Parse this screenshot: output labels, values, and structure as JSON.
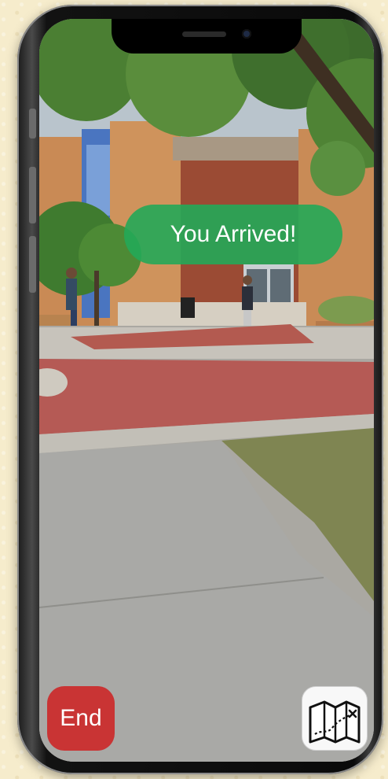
{
  "notification": {
    "text": "You Arrived!"
  },
  "controls": {
    "end_label": "End",
    "map_icon": "treasure-map-icon"
  },
  "colors": {
    "toast": "#24a858",
    "end_button": "#c93434",
    "map_button": "#f8f8f8"
  }
}
